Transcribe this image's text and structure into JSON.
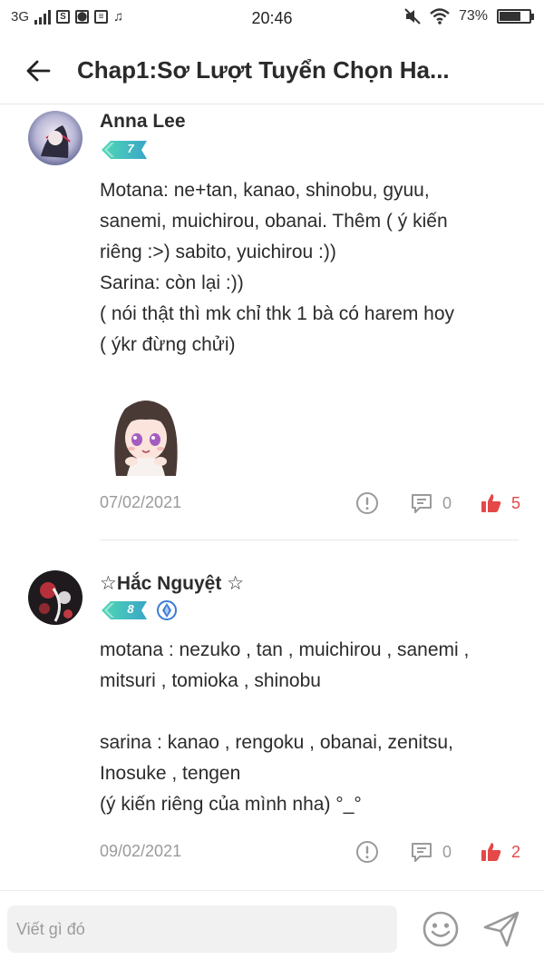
{
  "status_bar": {
    "network": "3G",
    "time": "20:46",
    "battery": "73%",
    "battery_level": 0.73,
    "icons": [
      "signal-icon",
      "sim-icon",
      "mic-icon",
      "news-icon",
      "music-icon",
      "mute-icon",
      "wifi-icon",
      "battery-icon"
    ]
  },
  "header": {
    "title": "Chap1:Sơ Lượt Tuyển Chọn Ha...",
    "back_icon": "arrow-left-icon"
  },
  "comments": [
    {
      "author": "Anna Lee",
      "level": "7",
      "lines": [
        "Motana: ne+tan, kanao, shinobu, gyuu,",
        "sanemi, muichirou, obanai. Thêm ( ý kiến",
        "riêng :>) sabito, yuichirou :))",
        "Sarina: còn lại :))",
        "( nói thật thì mk chỉ thk 1 bà có harem hoy",
        "( ýkr đừng chửi)"
      ],
      "date": "07/02/2021",
      "reply_count": "0",
      "like_count": "5",
      "has_sticker": true
    },
    {
      "author": "☆Hắc Nguyệt ☆",
      "level": "8",
      "verified": true,
      "lines": [
        "motana : nezuko , tan , muichirou , sanemi ,",
        "mitsuri , tomioka , shinobu",
        "",
        "sarina : kanao , rengoku , obanai, zenitsu,",
        "Inosuke , tengen",
        "(ý kiến riêng của mình nha) °_°"
      ],
      "date": "09/02/2021",
      "reply_count": "0",
      "like_count": "2"
    }
  ],
  "composer": {
    "placeholder": "Viết gì đó",
    "emoji_icon": "smiley-icon",
    "send_icon": "send-icon"
  },
  "colors": {
    "like": "#e54848",
    "badge_start": "#4fd8b4",
    "badge_end": "#3aa6c8",
    "muted": "#9a9a9a"
  }
}
